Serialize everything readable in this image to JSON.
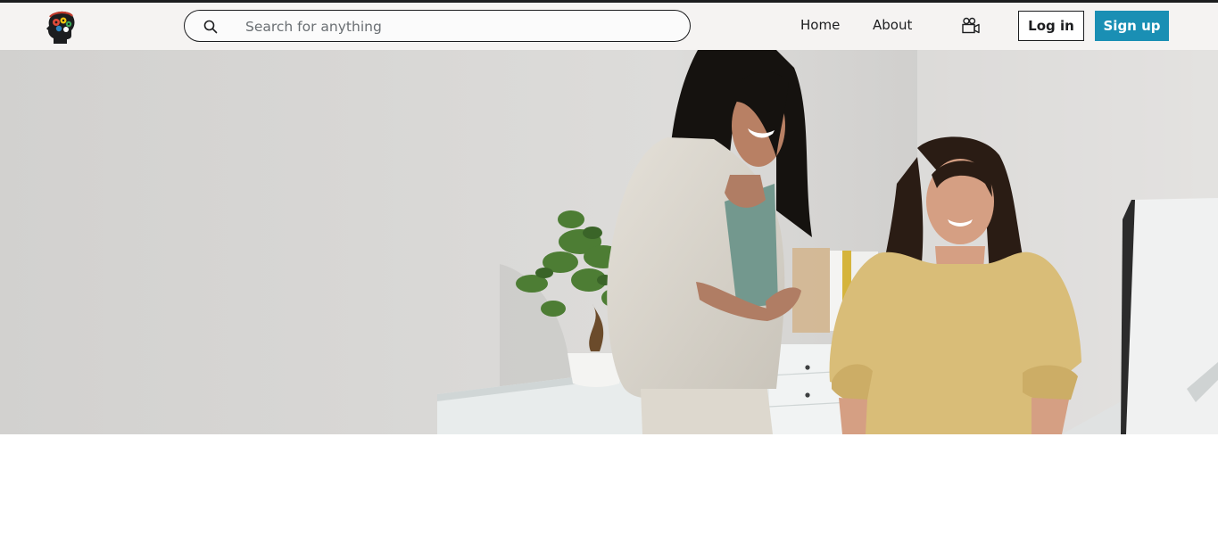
{
  "header": {
    "logo": {
      "icon": "head-gears-logo-icon"
    },
    "search": {
      "placeholder": "Search for anything",
      "icon": "search-icon"
    },
    "nav": [
      {
        "label": "Home"
      },
      {
        "label": "About"
      }
    ],
    "video_icon": "video-camera-icon",
    "login_label": "Log in",
    "signup_label": "Sign up"
  },
  "hero": {
    "image": "hero-office-photo",
    "subjects": [
      "woman-in-linen-suit",
      "woman-in-yellow-blouse",
      "bonsai-plant",
      "desk",
      "monitor"
    ]
  },
  "colors": {
    "accent": "#1a8fb4",
    "navbar_bg": "#f5f3f2",
    "text": "#1c1d1f",
    "hero_wall": "#d6d5d3"
  }
}
